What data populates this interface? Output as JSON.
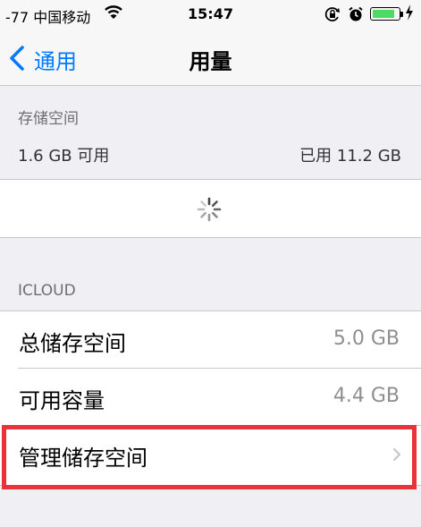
{
  "status_bar": {
    "carrier": "-77 中国移动",
    "time": "15:47"
  },
  "nav": {
    "back_label": "通用",
    "title": "用量"
  },
  "storage": {
    "header": "存储空间",
    "available": "1.6 GB 可用",
    "used": "已用 11.2 GB"
  },
  "icloud": {
    "header": "ICLOUD",
    "rows": [
      {
        "label": "总储存空间",
        "value": "5.0 GB"
      },
      {
        "label": "可用容量",
        "value": "4.4 GB"
      },
      {
        "label": "管理储存空间"
      }
    ]
  },
  "colors": {
    "accent": "#007aff",
    "battery": "#4cd964",
    "highlight": "#e8333a"
  },
  "battery_level": 0.85
}
